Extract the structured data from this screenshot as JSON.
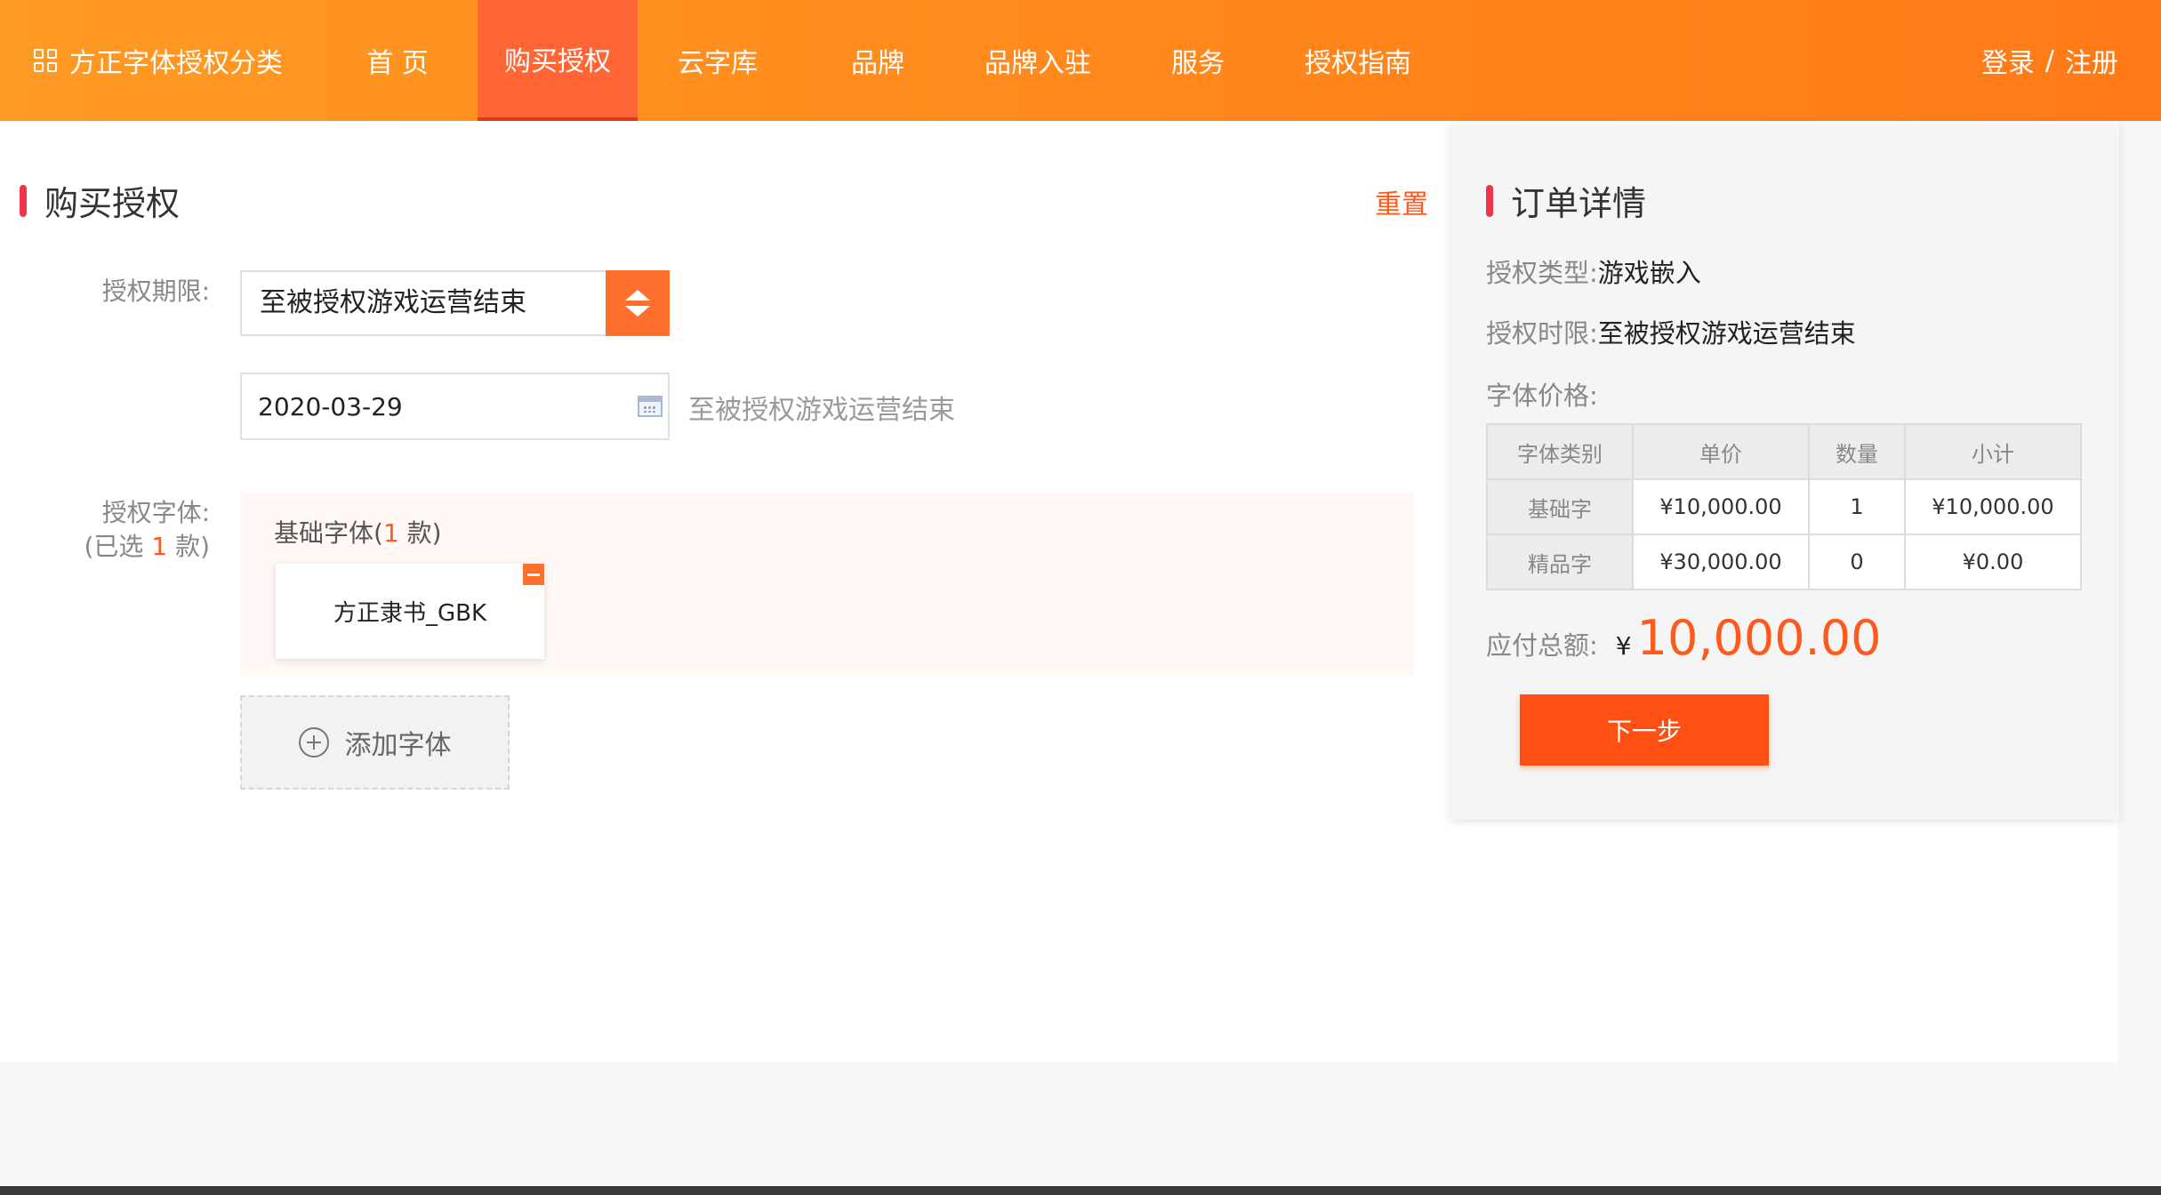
{
  "nav": {
    "logo_label": "方正字体授权分类",
    "items": [
      {
        "label": "首 页"
      },
      {
        "label": "购买授权"
      },
      {
        "label": "云字库"
      },
      {
        "label": "品牌"
      },
      {
        "label": "品牌入驻"
      },
      {
        "label": "服务"
      },
      {
        "label": "授权指南"
      }
    ],
    "active_index": 1,
    "login": "登录",
    "separator": "/",
    "register": "注册"
  },
  "purchase": {
    "title": "购买授权",
    "reset": "重置",
    "period_label": "授权期限:",
    "period_value": "至被授权游戏运营结束",
    "start_date": "2020-03-29",
    "end_hint": "至被授权游戏运营结束",
    "font_label": "授权字体:",
    "selected_prefix": "(已选",
    "selected_count": "1",
    "selected_suffix": "款)",
    "font_group": {
      "name": "基础字体(",
      "count": "1",
      "suffix": " 款)"
    },
    "fonts": [
      {
        "name": "方正隶书_GBK"
      }
    ],
    "add_font": "添加字体"
  },
  "order": {
    "title": "订单详情",
    "license_type_label": "授权类型:",
    "license_type": "游戏嵌入",
    "license_period_label": "授权时限:",
    "license_period": "至被授权游戏运营结束",
    "price_label": "字体价格:",
    "table": {
      "headers": [
        "字体类别",
        "单价",
        "数量",
        "小计"
      ],
      "rows": [
        [
          "基础字",
          "¥10,000.00",
          "1",
          "¥10,000.00"
        ],
        [
          "精品字",
          "¥30,000.00",
          "0",
          "¥0.00"
        ]
      ]
    },
    "total_label": "应付总额:",
    "currency": "¥",
    "total": "10,000.00",
    "next": "下一步"
  },
  "colors": {
    "nav_orange": "#ff8a1d",
    "accent": "#ff5a1c",
    "title_bar": "#f0344a"
  }
}
